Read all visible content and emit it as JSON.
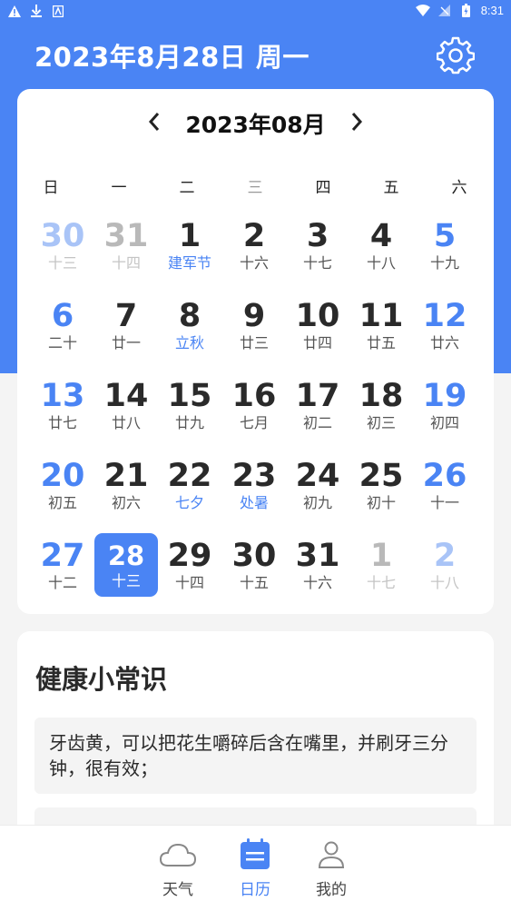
{
  "status_bar": {
    "time": "8:31",
    "left_icons": [
      "warning-icon",
      "download-icon",
      "notification-icon"
    ],
    "right_icons": [
      "wifi-icon",
      "signal-icon",
      "battery-icon"
    ]
  },
  "header": {
    "title": "2023年8月28日 周一",
    "settings_icon": "gear-icon"
  },
  "calendar": {
    "month_label": "2023年08月",
    "prev_symbol": "‹",
    "next_symbol": "›",
    "weekdays": [
      "日",
      "一",
      "二",
      "三",
      "四",
      "五",
      "六"
    ],
    "days": [
      {
        "num": "30",
        "lunar": "十三",
        "other": true
      },
      {
        "num": "31",
        "lunar": "十四",
        "other": true
      },
      {
        "num": "1",
        "lunar": "建军节",
        "festival": true
      },
      {
        "num": "2",
        "lunar": "十六"
      },
      {
        "num": "3",
        "lunar": "十七"
      },
      {
        "num": "4",
        "lunar": "十八"
      },
      {
        "num": "5",
        "lunar": "十九"
      },
      {
        "num": "6",
        "lunar": "二十"
      },
      {
        "num": "7",
        "lunar": "廿一"
      },
      {
        "num": "8",
        "lunar": "立秋",
        "festival": true
      },
      {
        "num": "9",
        "lunar": "廿三"
      },
      {
        "num": "10",
        "lunar": "廿四"
      },
      {
        "num": "11",
        "lunar": "廿五"
      },
      {
        "num": "12",
        "lunar": "廿六"
      },
      {
        "num": "13",
        "lunar": "廿七"
      },
      {
        "num": "14",
        "lunar": "廿八"
      },
      {
        "num": "15",
        "lunar": "廿九"
      },
      {
        "num": "16",
        "lunar": "七月"
      },
      {
        "num": "17",
        "lunar": "初二"
      },
      {
        "num": "18",
        "lunar": "初三"
      },
      {
        "num": "19",
        "lunar": "初四"
      },
      {
        "num": "20",
        "lunar": "初五"
      },
      {
        "num": "21",
        "lunar": "初六"
      },
      {
        "num": "22",
        "lunar": "七夕",
        "festival": true
      },
      {
        "num": "23",
        "lunar": "处暑",
        "festival": true
      },
      {
        "num": "24",
        "lunar": "初九"
      },
      {
        "num": "25",
        "lunar": "初十"
      },
      {
        "num": "26",
        "lunar": "十一"
      },
      {
        "num": "27",
        "lunar": "十二"
      },
      {
        "num": "28",
        "lunar": "十三",
        "selected": true
      },
      {
        "num": "29",
        "lunar": "十四"
      },
      {
        "num": "30",
        "lunar": "十五"
      },
      {
        "num": "31",
        "lunar": "十六"
      },
      {
        "num": "1",
        "lunar": "十七",
        "other": true
      },
      {
        "num": "2",
        "lunar": "十八",
        "other": true
      }
    ]
  },
  "health": {
    "title": "健康小常识",
    "tips": [
      "牙齿黄，可以把花生嚼碎后含在嘴里，并刷牙三分钟，很有效；",
      ""
    ]
  },
  "tabbar": {
    "tabs": [
      {
        "label": "天气",
        "icon": "cloud-icon",
        "active": false
      },
      {
        "label": "日历",
        "icon": "calendar-icon",
        "active": true
      },
      {
        "label": "我的",
        "icon": "person-icon",
        "active": false
      }
    ]
  },
  "colors": {
    "accent": "#4a84f4",
    "background": "#f4f4f4",
    "card": "#ffffff"
  }
}
